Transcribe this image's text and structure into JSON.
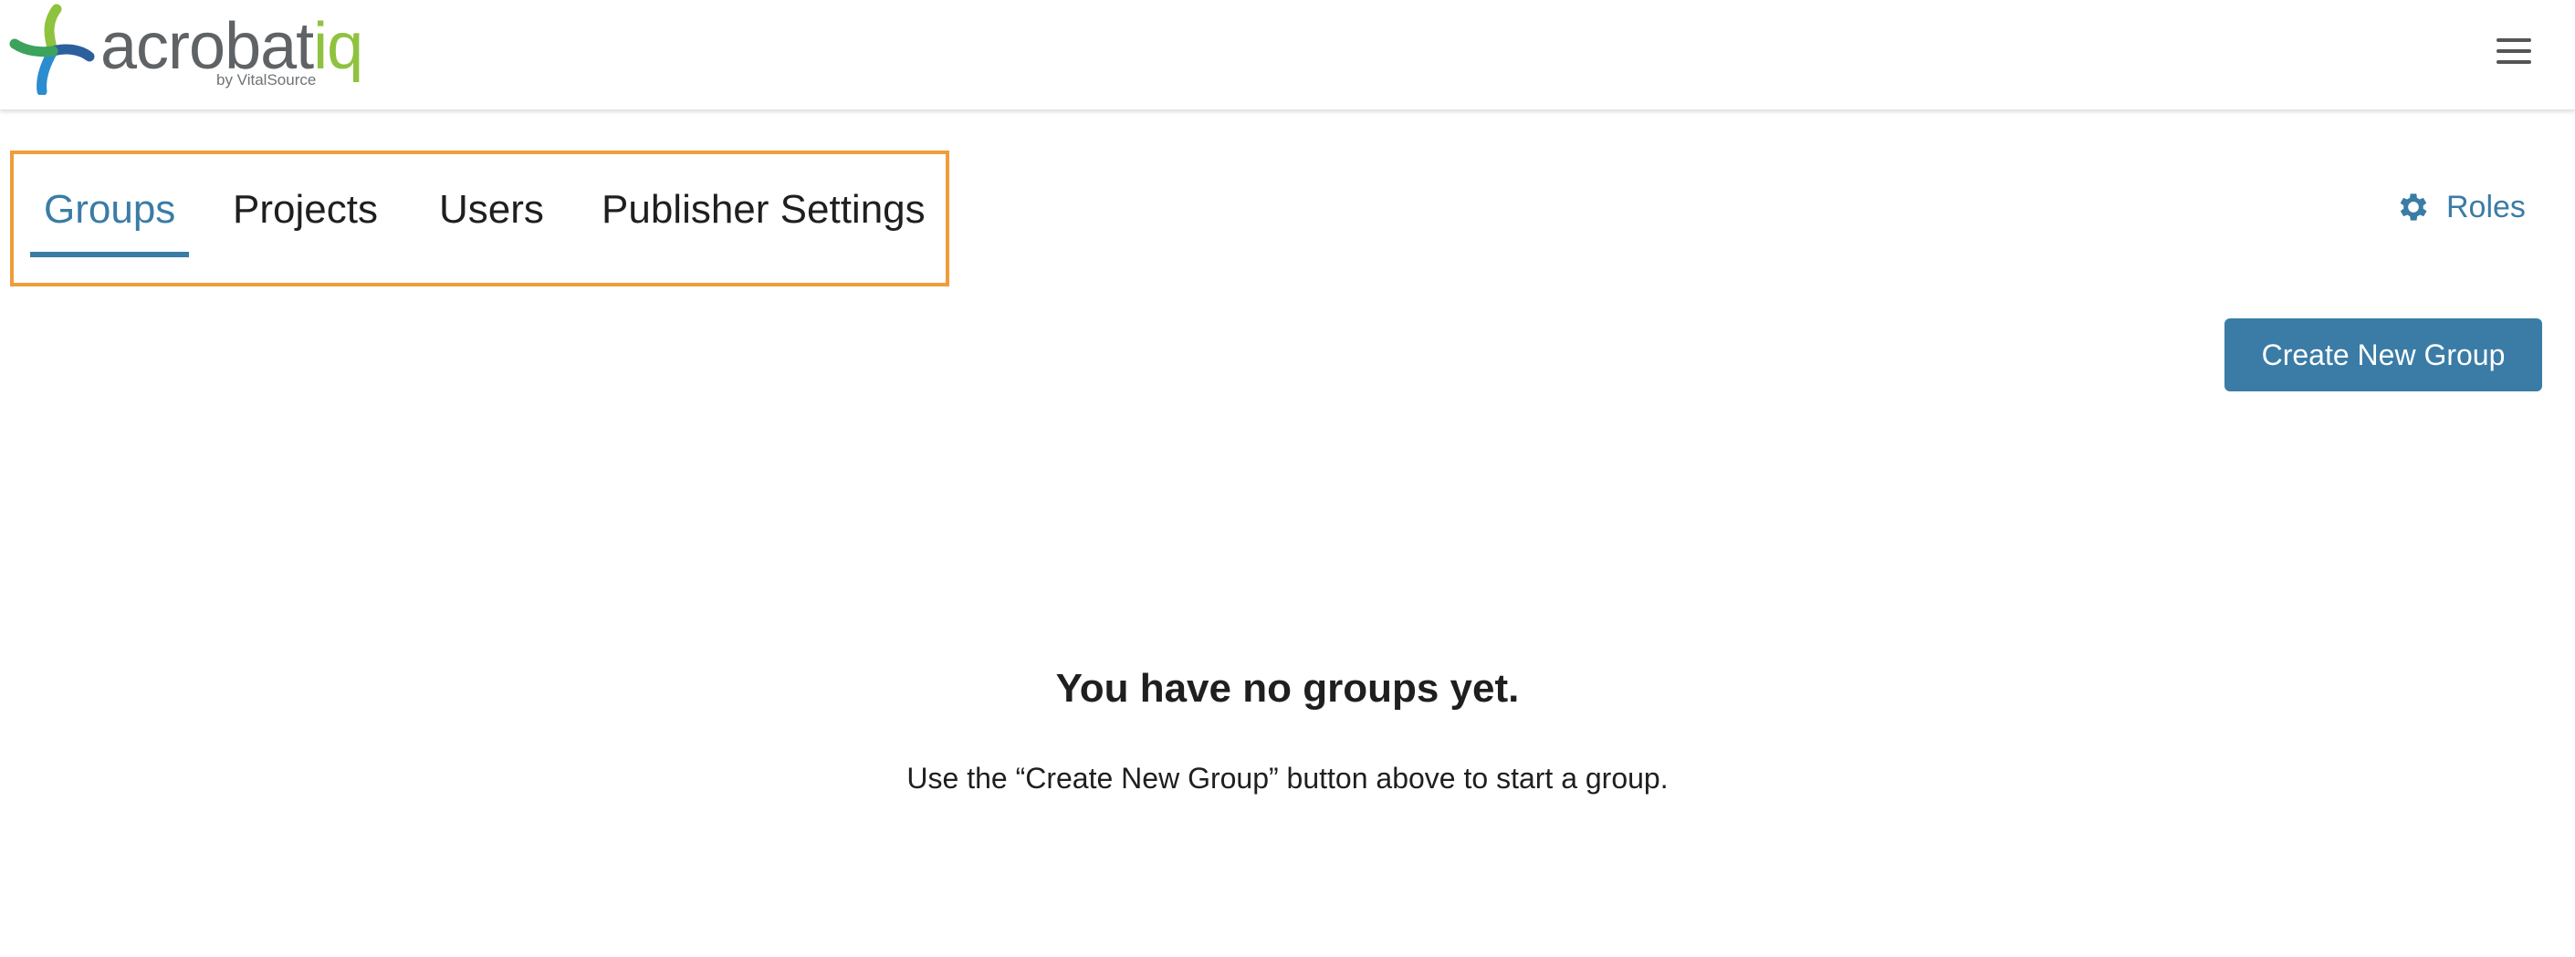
{
  "header": {
    "logo": {
      "wordmark_main": "acrobat",
      "wordmark_accent": "iq",
      "byline": "by VitalSource"
    },
    "menu_icon": "hamburger-menu-icon"
  },
  "tabs": [
    {
      "label": "Groups",
      "active": true
    },
    {
      "label": "Projects",
      "active": false
    },
    {
      "label": "Users",
      "active": false
    },
    {
      "label": "Publisher Settings",
      "active": false
    }
  ],
  "roles": {
    "label": "Roles",
    "icon": "gear-icon"
  },
  "actions": {
    "create_label": "Create New Group"
  },
  "empty_state": {
    "title": "You have no groups yet.",
    "message": "Use the “Create New Group” button above to start a group."
  },
  "colors": {
    "accent": "#3a7ca5",
    "highlight_border": "#ef9d3a",
    "logo_green": "#8fc23e",
    "logo_gray": "#5f6366"
  }
}
